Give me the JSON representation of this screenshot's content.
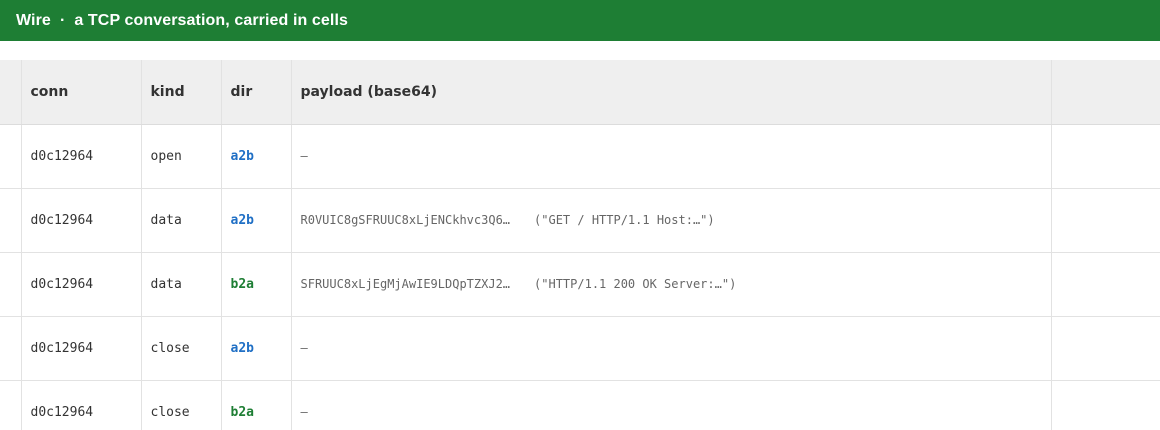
{
  "header": {
    "app_name": "Wire",
    "separator": "·",
    "subtitle": "a TCP conversation, carried in cells"
  },
  "table": {
    "columns": [
      "conn",
      "kind",
      "dir",
      "payload (base64)"
    ],
    "rows": [
      {
        "conn": "d0c12964",
        "kind": "open",
        "dir": "a2b",
        "payload": "—",
        "decoded": ""
      },
      {
        "conn": "d0c12964",
        "kind": "data",
        "dir": "a2b",
        "payload": "R0VUIC8gSFRUUC8xLjENCkhvc3Q6…",
        "decoded": "(\"GET / HTTP/1.1  Host:…\")"
      },
      {
        "conn": "d0c12964",
        "kind": "data",
        "dir": "b2a",
        "payload": "SFRUUC8xLjEgMjAwIE9LDQpTZXJ2…",
        "decoded": "(\"HTTP/1.1 200 OK  Server:…\")"
      },
      {
        "conn": "d0c12964",
        "kind": "close",
        "dir": "a2b",
        "payload": "—",
        "decoded": ""
      },
      {
        "conn": "d0c12964",
        "kind": "close",
        "dir": "b2a",
        "payload": "—",
        "decoded": ""
      }
    ]
  },
  "colors": {
    "header_bg": "#1e7e34",
    "dir_a2b": "#1f6fc5",
    "dir_b2a": "#1e7e34"
  }
}
